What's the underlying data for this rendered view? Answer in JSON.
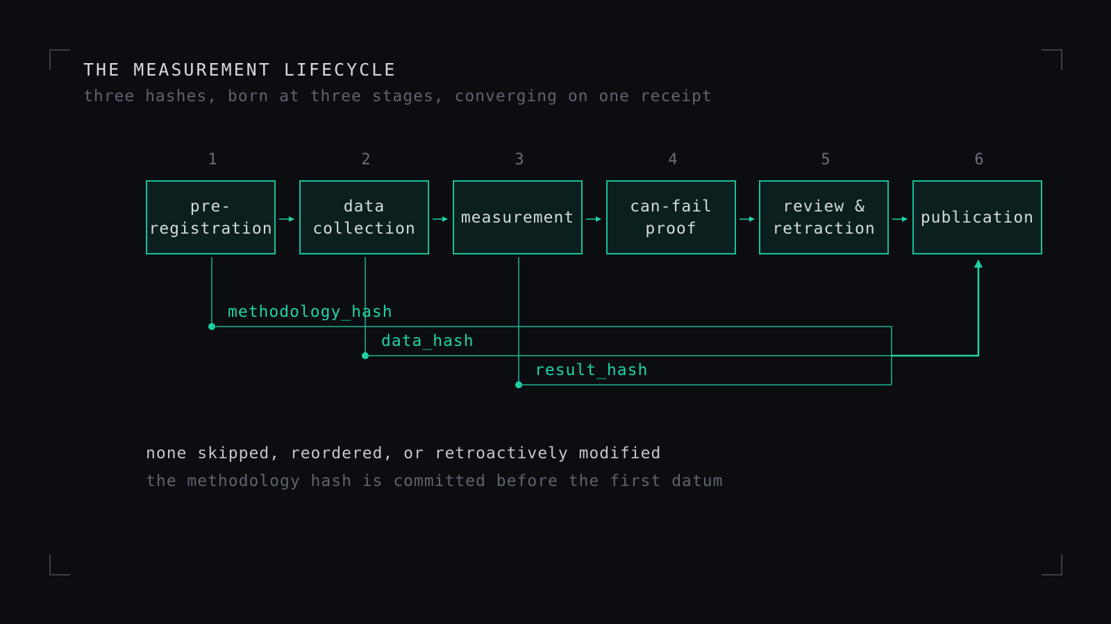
{
  "header": {
    "title": "THE MEASUREMENT LIFECYCLE",
    "subtitle": "three hashes, born at three stages, converging on one receipt"
  },
  "stages": [
    {
      "number": "1",
      "label": "pre-\nregistration"
    },
    {
      "number": "2",
      "label": "data\ncollection"
    },
    {
      "number": "3",
      "label": "measurement"
    },
    {
      "number": "4",
      "label": "can-fail\nproof"
    },
    {
      "number": "5",
      "label": "review &\nretraction"
    },
    {
      "number": "6",
      "label": "publication"
    }
  ],
  "hashes": [
    {
      "label": "methodology_hash",
      "from_stage": "1"
    },
    {
      "label": "data_hash",
      "from_stage": "2"
    },
    {
      "label": "result_hash",
      "from_stage": "3"
    }
  ],
  "footer": {
    "note": "none skipped, reordered, or retroactively modified",
    "subnote": "the methodology hash is committed before the first datum"
  },
  "colors": {
    "background": "#0b0d11",
    "accent": "#1fd3a6",
    "box_fill": "#0a1f1e",
    "text": "#d6dadf",
    "muted": "#5f646d"
  }
}
